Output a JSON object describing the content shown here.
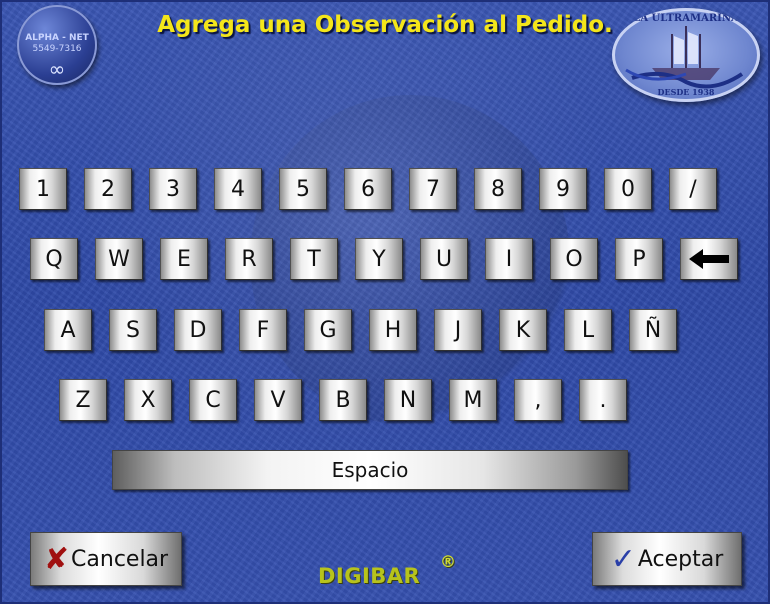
{
  "header": {
    "title": "Agrega una Observación al Pedido."
  },
  "logo_left": {
    "line1": "ALPHA - NET",
    "line2": "5549-7316",
    "symbol": "∞"
  },
  "logo_right": {
    "name": "LA ULTRAMARINA",
    "tagline": "DESDE 1938"
  },
  "keyboard": {
    "row1": [
      "1",
      "2",
      "3",
      "4",
      "5",
      "6",
      "7",
      "8",
      "9",
      "0",
      "/"
    ],
    "row2": [
      "Q",
      "W",
      "E",
      "R",
      "T",
      "Y",
      "U",
      "I",
      "O",
      "P"
    ],
    "backspace_icon": "left-arrow-icon",
    "row3": [
      "A",
      "S",
      "D",
      "F",
      "G",
      "H",
      "J",
      "K",
      "L",
      "Ñ"
    ],
    "row4": [
      "Z",
      "X",
      "C",
      "V",
      "B",
      "N",
      "M",
      ",",
      "."
    ],
    "space_label": "Espacio"
  },
  "buttons": {
    "cancel_label": "Cancelar",
    "cancel_icon": "✘",
    "accept_label": "Aceptar",
    "accept_icon": "✓"
  },
  "footer": {
    "brand": "DIGIBAR",
    "registered": "®"
  },
  "colors": {
    "background": "#3450b0",
    "title": "#f4e61a",
    "brand": "#b7c31c"
  }
}
